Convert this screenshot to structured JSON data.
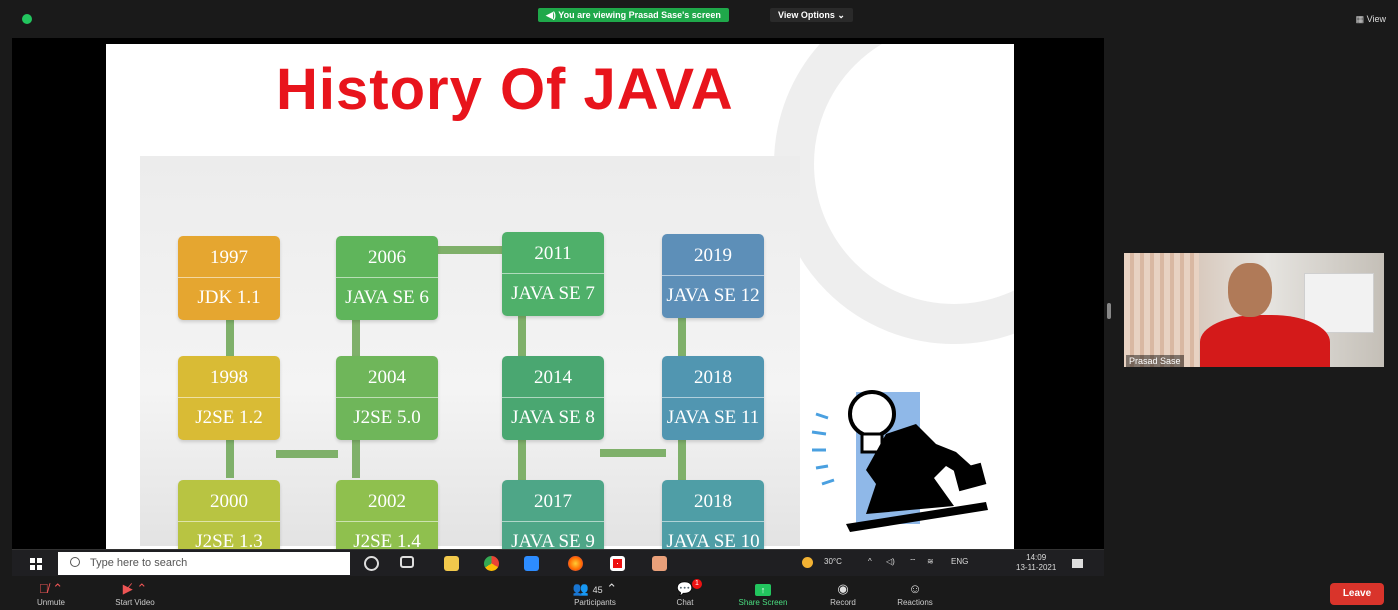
{
  "banner": {
    "viewing_text": "You are viewing Prasad Sase's screen",
    "view_options": "View Options",
    "view_label": "View"
  },
  "slide": {
    "title": "History Of JAVA",
    "boxes": [
      {
        "year": "1997",
        "version": "JDK 1.1",
        "color": "#e5a630"
      },
      {
        "year": "1998",
        "version": "J2SE 1.2",
        "color": "#d9bb35"
      },
      {
        "year": "2000",
        "version": "J2SE 1.3",
        "color": "#b8c442"
      },
      {
        "year": "2002",
        "version": "J2SE 1.4",
        "color": "#8fc04e"
      },
      {
        "year": "2004",
        "version": "J2SE 5.0",
        "color": "#6fb65a"
      },
      {
        "year": "2006",
        "version": "JAVA SE 6",
        "color": "#5fb55b"
      },
      {
        "year": "2011",
        "version": "JAVA SE 7",
        "color": "#4fb06a"
      },
      {
        "year": "2014",
        "version": "JAVA SE 8",
        "color": "#4aa771"
      },
      {
        "year": "2017",
        "version": "JAVA SE 9",
        "color": "#4ea687"
      },
      {
        "year": "2018",
        "version": "JAVA SE 10",
        "color": "#4f9ea6"
      },
      {
        "year": "2018",
        "version": "JAVA SE 11",
        "color": "#5196b1"
      },
      {
        "year": "2019",
        "version": "JAVA SE 12",
        "color": "#5d8fb8"
      }
    ]
  },
  "taskbar": {
    "search_placeholder": "Type here to search",
    "temperature": "30°C",
    "language": "ENG",
    "time": "14:09",
    "date": "13-11-2021"
  },
  "participant": {
    "name": "Prasad Sase"
  },
  "controls": {
    "unmute": "Unmute",
    "start_video": "Start Video",
    "participants": "Participants",
    "participant_count": "45",
    "chat": "Chat",
    "chat_badge": "1",
    "share_screen": "Share Screen",
    "record": "Record",
    "reactions": "Reactions",
    "leave": "Leave"
  }
}
